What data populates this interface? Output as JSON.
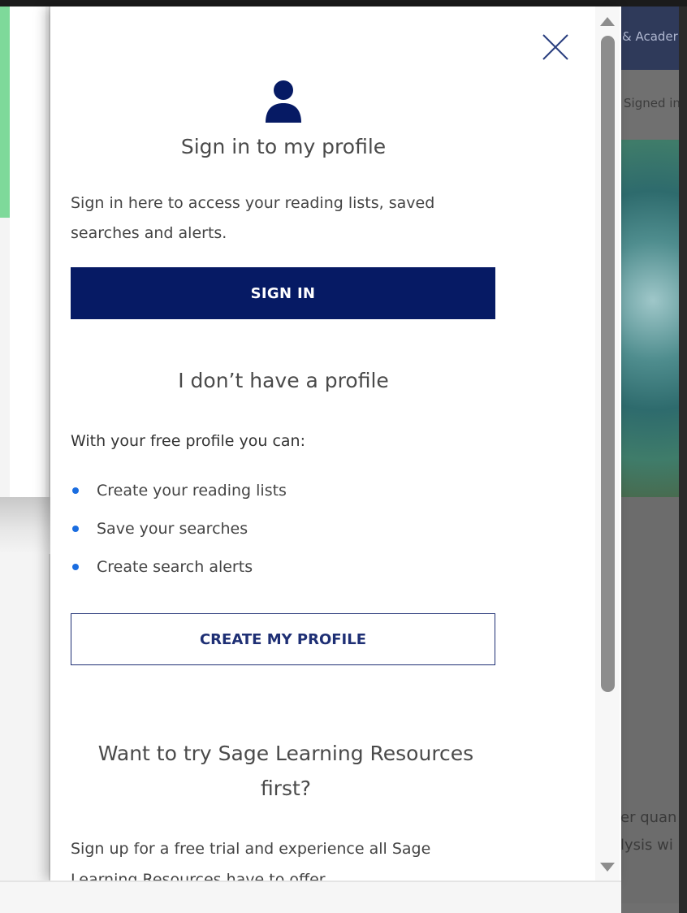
{
  "background": {
    "header_text": "& Acader",
    "signed_text": "Signed in",
    "lower_line_1": "er quan",
    "lower_line_2": "lysis wi"
  },
  "modal": {
    "close_icon": "close-icon",
    "user_icon": "user-icon",
    "signin_heading": "Sign in to my profile",
    "signin_description": "Sign in here to access your reading lists, saved searches and alerts.",
    "signin_button": "SIGN IN",
    "noprofile_heading": "I don’t have a profile",
    "free_profile_intro": "With your free profile you can:",
    "benefits": [
      "Create your reading lists",
      "Save your searches",
      "Create search alerts"
    ],
    "create_button": "CREATE MY PROFILE",
    "trial_heading": "Want to try Sage Learning Resources first?",
    "trial_description": "Sign up for a free trial and experience all Sage Learning Resources have to offer."
  },
  "colors": {
    "primary": "#061a64",
    "bullet": "#1a6de0",
    "text": "#444444"
  }
}
